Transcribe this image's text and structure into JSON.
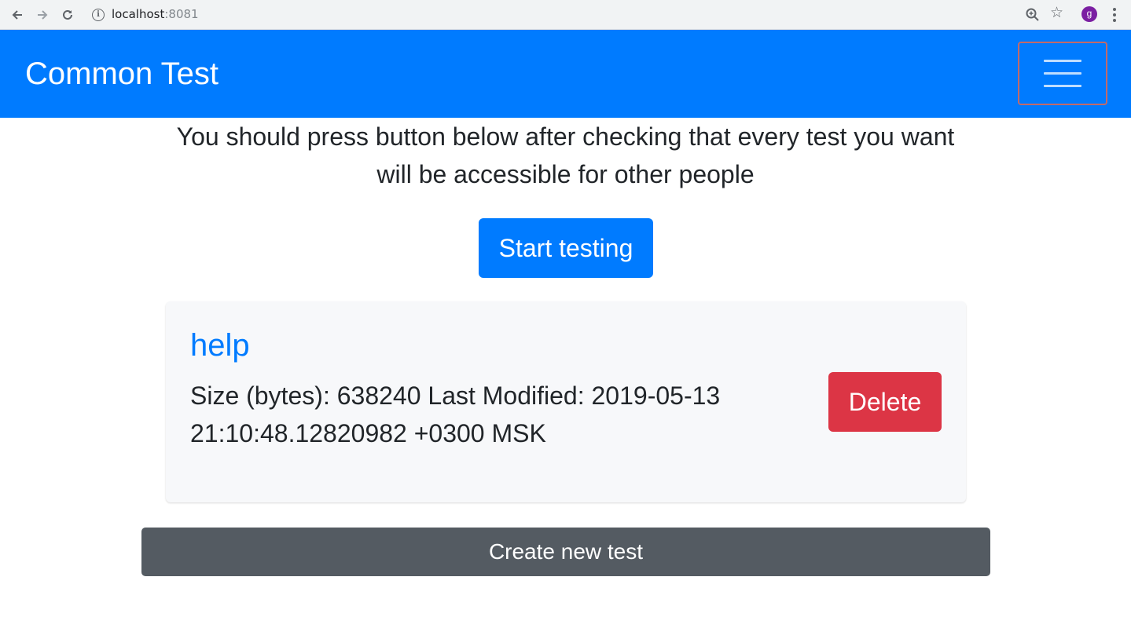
{
  "browser": {
    "url_host": "localhost",
    "url_port": ":8081",
    "info_icon": "info-icon",
    "avatar_letter": "g",
    "avatar_color": "#7b1fa2"
  },
  "navbar": {
    "brand": "Common Test",
    "color": "#007bff"
  },
  "main": {
    "notice": "You should press button below after checking that every test you want will be accessible for other people",
    "start_button": "Start testing"
  },
  "tests": [
    {
      "name": "help",
      "meta": "Size (bytes): 638240 Last Modified: 2019-05-13 21:10:48.12820982 +0300 MSK",
      "delete_label": "Delete"
    }
  ],
  "footer": {
    "create_button": "Create new test"
  },
  "colors": {
    "primary": "#007bff",
    "danger": "#dc3545",
    "secondary": "#545b62"
  }
}
